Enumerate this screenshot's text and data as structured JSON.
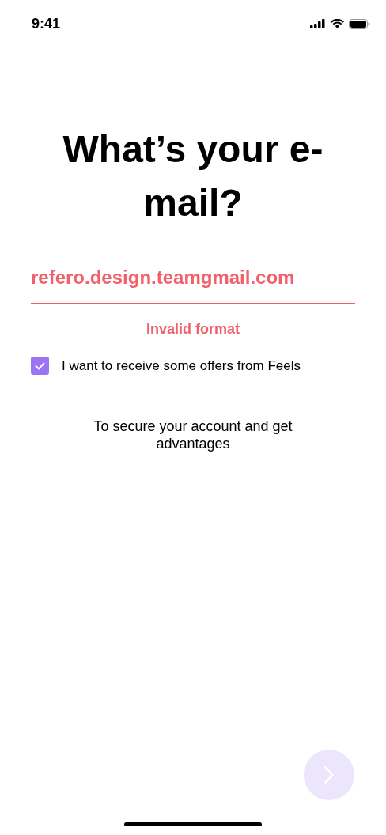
{
  "status_bar": {
    "time": "9:41"
  },
  "title": "What’s your e-mail?",
  "email_field": {
    "value": "refero.design.teamgmail.com",
    "invalid": true
  },
  "error_message": "Invalid format",
  "offers_checkbox": {
    "label": "I want to receive some offers from Feels",
    "checked": true
  },
  "subtitle": "To secure your account and get advantages",
  "next_button": {
    "disabled": true
  }
}
